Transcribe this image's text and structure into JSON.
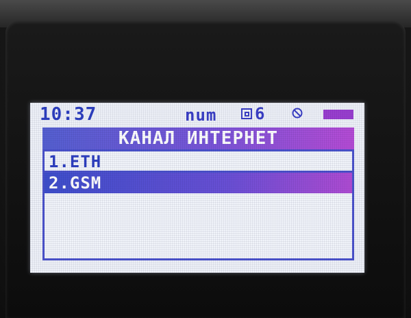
{
  "status": {
    "time": "10:37",
    "input_mode": "num",
    "lang_number": "6",
    "icons": [
      "keyboard-layout-icon",
      "no-connection-icon",
      "battery-icon"
    ]
  },
  "header": {
    "title": "КАНАЛ ИНТЕРНЕТ"
  },
  "menu": {
    "items": [
      {
        "label": "1.ETH",
        "selected": false
      },
      {
        "label": "2.GSM",
        "selected": true
      }
    ]
  },
  "colors": {
    "lcd_background": "#eef1f8",
    "text_blue": "#2d3fc0",
    "highlight_start": "#3e4fcc",
    "highlight_end": "#b04cd4",
    "battery": "#9a3fd0"
  }
}
